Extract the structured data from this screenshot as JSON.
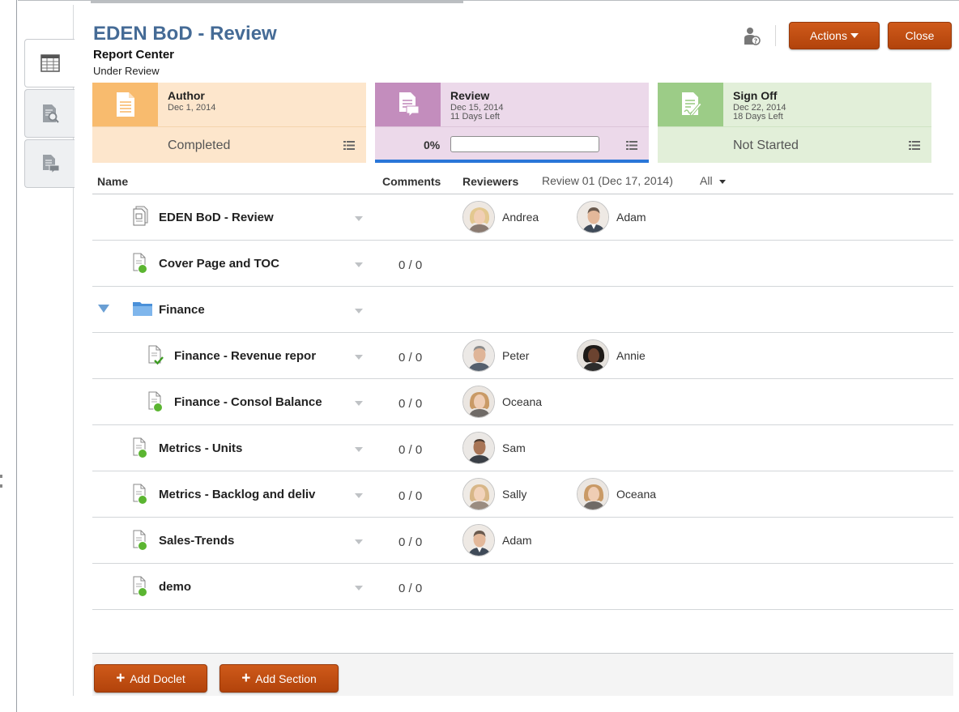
{
  "header": {
    "title": "EDEN BoD - Review",
    "subtitle": "Report Center",
    "status": "Under Review",
    "actions_label": "Actions",
    "close_label": "Close"
  },
  "tabs": [
    {
      "icon": "table-grid-icon",
      "active": true
    },
    {
      "icon": "document-search-icon",
      "active": false
    },
    {
      "icon": "document-comment-icon",
      "active": false
    }
  ],
  "stages": {
    "author": {
      "name": "Author",
      "date": "Dec 1, 2014",
      "state": "Completed",
      "color": "#f8bb6e"
    },
    "review": {
      "name": "Review",
      "date": "Dec 15, 2014",
      "days_left": "11 Days Left",
      "progress_label": "0%",
      "progress": 0,
      "color": "#c38dbd"
    },
    "signoff": {
      "name": "Sign Off",
      "date": "Dec 22, 2014",
      "days_left": "18 Days Left",
      "state": "Not Started",
      "color": "#9ccc87"
    }
  },
  "table": {
    "col_name": "Name",
    "col_comments": "Comments",
    "col_reviewers": "Reviewers",
    "review_round": "Review 01 (Dec 17, 2014)",
    "filter": "All"
  },
  "rows": [
    {
      "name": "EDEN BoD - Review",
      "comments": "",
      "reviewers": [
        "Andrea",
        "Adam"
      ]
    },
    {
      "name": "Cover Page and TOC",
      "comments": "0 / 0",
      "reviewers": []
    },
    {
      "name": "Finance",
      "comments": "",
      "reviewers": []
    },
    {
      "name": "Finance - Revenue repor",
      "comments": "0 / 0",
      "reviewers": [
        "Peter",
        "Annie"
      ]
    },
    {
      "name": "Finance - Consol Balance",
      "comments": "0 / 0",
      "reviewers": [
        "Oceana"
      ]
    },
    {
      "name": "Metrics - Units",
      "comments": "0 / 0",
      "reviewers": [
        "Sam"
      ]
    },
    {
      "name": "Metrics - Backlog and deliv",
      "comments": "0 / 0",
      "reviewers": [
        "Sally",
        "Oceana"
      ]
    },
    {
      "name": "Sales-Trends",
      "comments": "0 / 0",
      "reviewers": [
        "Adam"
      ]
    },
    {
      "name": "demo",
      "comments": "0 / 0",
      "reviewers": []
    }
  ],
  "footer": {
    "add_doclet_label": "Add Doclet",
    "add_section_label": "Add Section"
  },
  "colors": {
    "accent": "#b2430b",
    "title": "#456b96",
    "progress": "#2a76d8",
    "status_dot": "#5bb531"
  }
}
